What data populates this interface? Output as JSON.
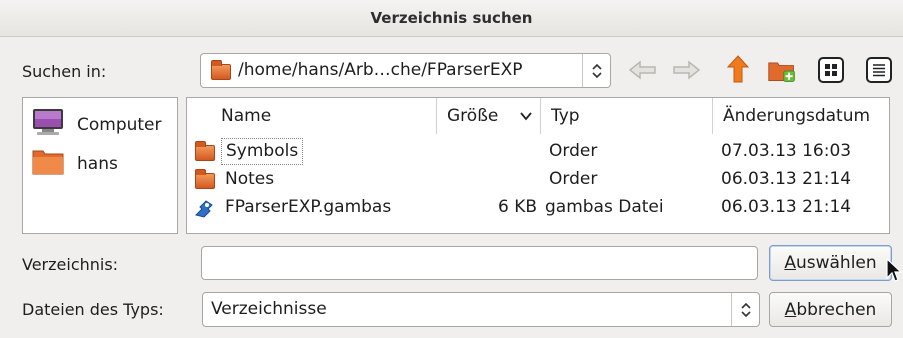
{
  "window": {
    "title": "Verzeichnis suchen"
  },
  "location": {
    "label": "Suchen in:",
    "path": "/home/hans/Arb…che/FParserEXP",
    "toolbar_icons": [
      "arrow-left-icon",
      "arrow-right-icon",
      "arrow-up-icon",
      "new-folder-icon",
      "icon-view-icon",
      "detail-view-icon"
    ]
  },
  "sidebar": {
    "items": [
      {
        "label": "Computer",
        "icon": "computer-icon"
      },
      {
        "label": "hans",
        "icon": "folder-icon"
      }
    ]
  },
  "file_list": {
    "columns": {
      "name": "Name",
      "size": "Größe",
      "type": "Typ",
      "date": "Änderungsdatum"
    },
    "rows": [
      {
        "name": "Symbols",
        "size": "",
        "type": "Order",
        "date": "07.03.13 16:03",
        "icon": "folder-icon"
      },
      {
        "name": "Notes",
        "size": "",
        "type": "Order",
        "date": "06.03.13 21:14",
        "icon": "folder-icon"
      },
      {
        "name": "FParserEXP.gambas",
        "size": "6 KB",
        "type": "gambas Datei",
        "date": "06.03.13 21:14",
        "icon": "gambas-file-icon"
      }
    ]
  },
  "directory": {
    "label": "Verzeichnis:",
    "value": "",
    "placeholder": ""
  },
  "filetype": {
    "label": "Dateien des Typs:",
    "selected": "Verzeichnisse"
  },
  "buttons": {
    "select": {
      "mnemonic": "A",
      "rest": "uswählen"
    },
    "cancel": {
      "mnemonic": "A",
      "rest": "bbrechen"
    }
  },
  "colors": {
    "folder": "#e06a2c",
    "accent_arrow": "#f07a1e",
    "background": "#f0efed"
  }
}
